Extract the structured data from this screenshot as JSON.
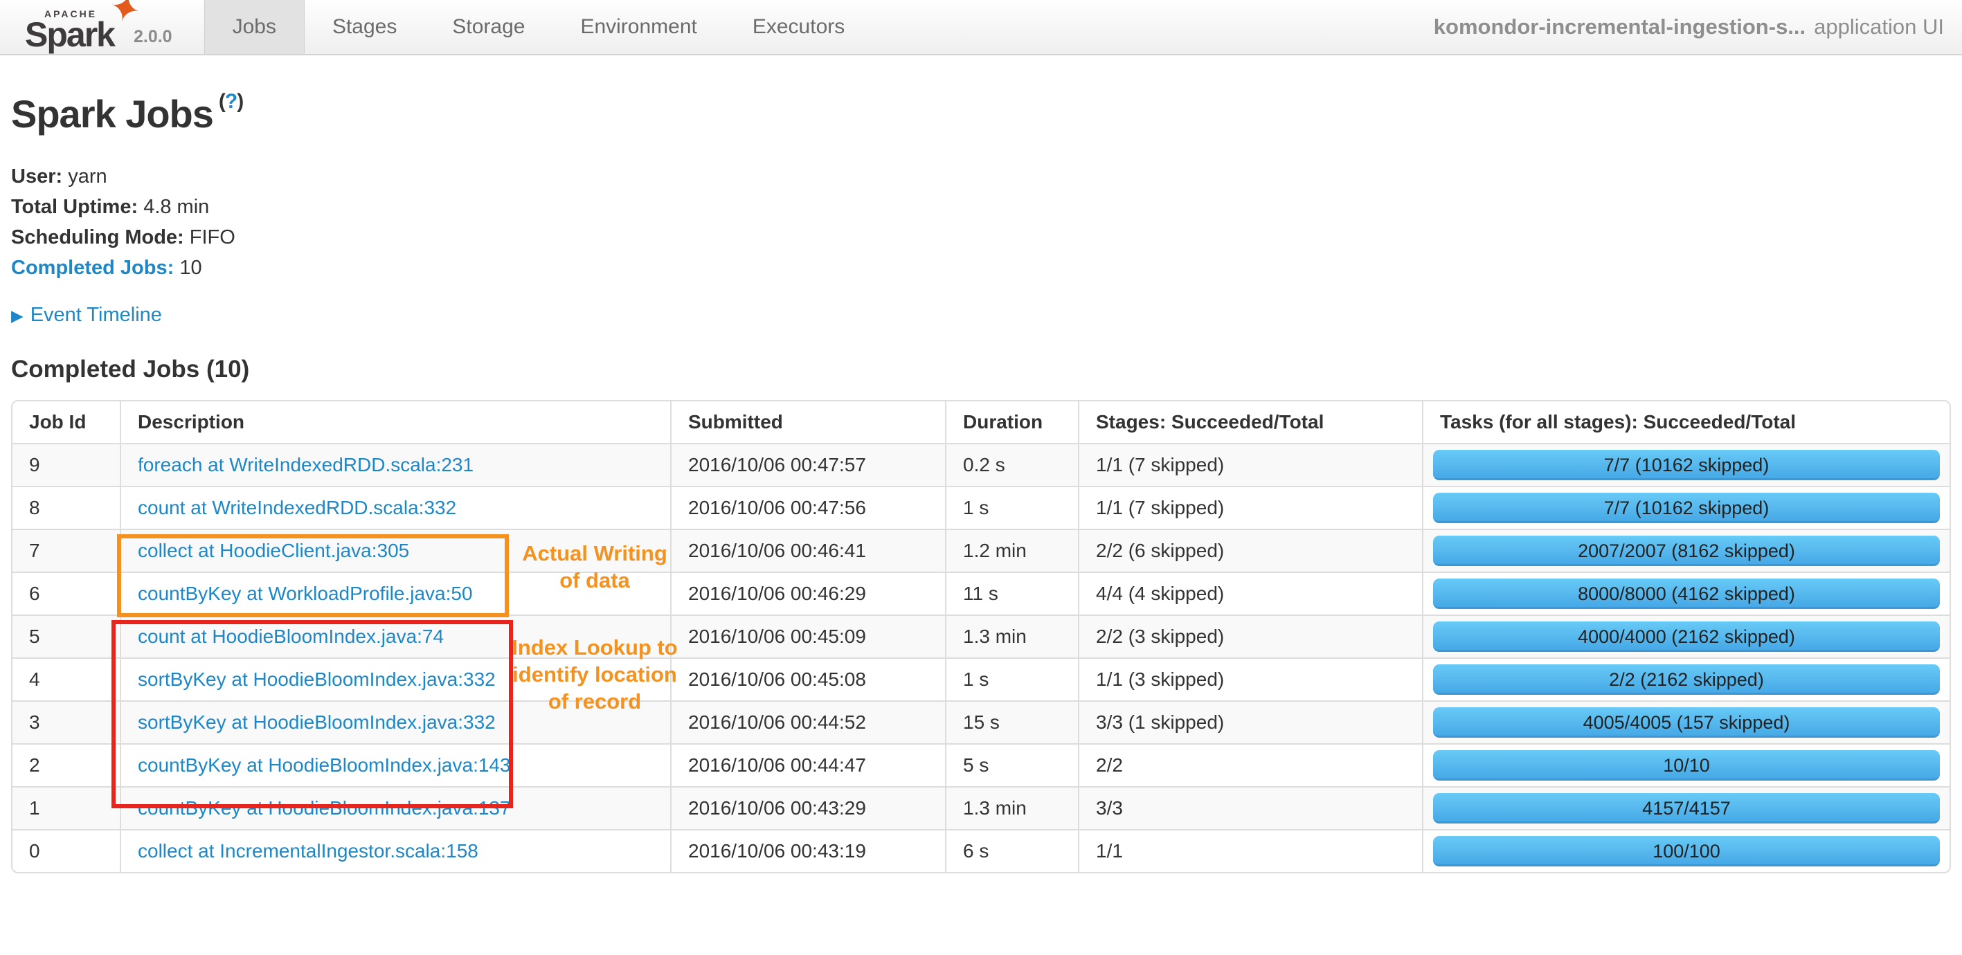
{
  "nav": {
    "logo": {
      "apache": "APACHE",
      "name": "Spark",
      "version": "2.0.0"
    },
    "tabs": [
      {
        "label": "Jobs",
        "active": true
      },
      {
        "label": "Stages",
        "active": false
      },
      {
        "label": "Storage",
        "active": false
      },
      {
        "label": "Environment",
        "active": false
      },
      {
        "label": "Executors",
        "active": false
      }
    ],
    "app_title": {
      "name": "komondor-incremental-ingestion-s...",
      "suffix": "application UI"
    }
  },
  "page": {
    "title": "Spark Jobs",
    "help": {
      "open": "(",
      "q": "?",
      "close": ")"
    },
    "info": {
      "user_label": "User:",
      "user_value": "yarn",
      "uptime_label": "Total Uptime:",
      "uptime_value": "4.8 min",
      "sched_label": "Scheduling Mode:",
      "sched_value": "FIFO",
      "completed_label": "Completed Jobs:",
      "completed_value": "10"
    },
    "timeline": {
      "icon": "▶",
      "label": "Event Timeline"
    },
    "section_title": "Completed Jobs (10)"
  },
  "table": {
    "headers": [
      "Job Id",
      "Description",
      "Submitted",
      "Duration",
      "Stages: Succeeded/Total",
      "Tasks (for all stages): Succeeded/Total"
    ],
    "rows": [
      {
        "id": "9",
        "description": "foreach at WriteIndexedRDD.scala:231",
        "submitted": "2016/10/06 00:47:57",
        "duration": "0.2 s",
        "stages": "1/1 (7 skipped)",
        "tasks": "7/7 (10162 skipped)"
      },
      {
        "id": "8",
        "description": "count at WriteIndexedRDD.scala:332",
        "submitted": "2016/10/06 00:47:56",
        "duration": "1 s",
        "stages": "1/1 (7 skipped)",
        "tasks": "7/7 (10162 skipped)"
      },
      {
        "id": "7",
        "description": "collect at HoodieClient.java:305",
        "submitted": "2016/10/06 00:46:41",
        "duration": "1.2 min",
        "stages": "2/2 (6 skipped)",
        "tasks": "2007/2007 (8162 skipped)"
      },
      {
        "id": "6",
        "description": "countByKey at WorkloadProfile.java:50",
        "submitted": "2016/10/06 00:46:29",
        "duration": "11 s",
        "stages": "4/4 (4 skipped)",
        "tasks": "8000/8000 (4162 skipped)"
      },
      {
        "id": "5",
        "description": "count at HoodieBloomIndex.java:74",
        "submitted": "2016/10/06 00:45:09",
        "duration": "1.3 min",
        "stages": "2/2 (3 skipped)",
        "tasks": "4000/4000 (2162 skipped)"
      },
      {
        "id": "4",
        "description": "sortByKey at HoodieBloomIndex.java:332",
        "submitted": "2016/10/06 00:45:08",
        "duration": "1 s",
        "stages": "1/1 (3 skipped)",
        "tasks": "2/2 (2162 skipped)"
      },
      {
        "id": "3",
        "description": "sortByKey at HoodieBloomIndex.java:332",
        "submitted": "2016/10/06 00:44:52",
        "duration": "15 s",
        "stages": "3/3 (1 skipped)",
        "tasks": "4005/4005 (157 skipped)"
      },
      {
        "id": "2",
        "description": "countByKey at HoodieBloomIndex.java:143",
        "submitted": "2016/10/06 00:44:47",
        "duration": "5 s",
        "stages": "2/2",
        "tasks": "10/10"
      },
      {
        "id": "1",
        "description": "countByKey at HoodieBloomIndex.java:137",
        "submitted": "2016/10/06 00:43:29",
        "duration": "1.3 min",
        "stages": "3/3",
        "tasks": "4157/4157"
      },
      {
        "id": "0",
        "description": "collect at IncrementalIngestor.scala:158",
        "submitted": "2016/10/06 00:43:19",
        "duration": "6 s",
        "stages": "1/1",
        "tasks": "100/100"
      }
    ]
  },
  "annotations": {
    "orange_box_label": "Actual Writing of data",
    "red_box_label": "Index Lookup to identify location of record"
  },
  "colors": {
    "link_blue": "#1d87c8",
    "annotation_orange": "#f5921e",
    "annotation_red": "#e8251c",
    "progress_bar_top": "#68caf6",
    "progress_bar_bottom": "#47a9e6"
  }
}
